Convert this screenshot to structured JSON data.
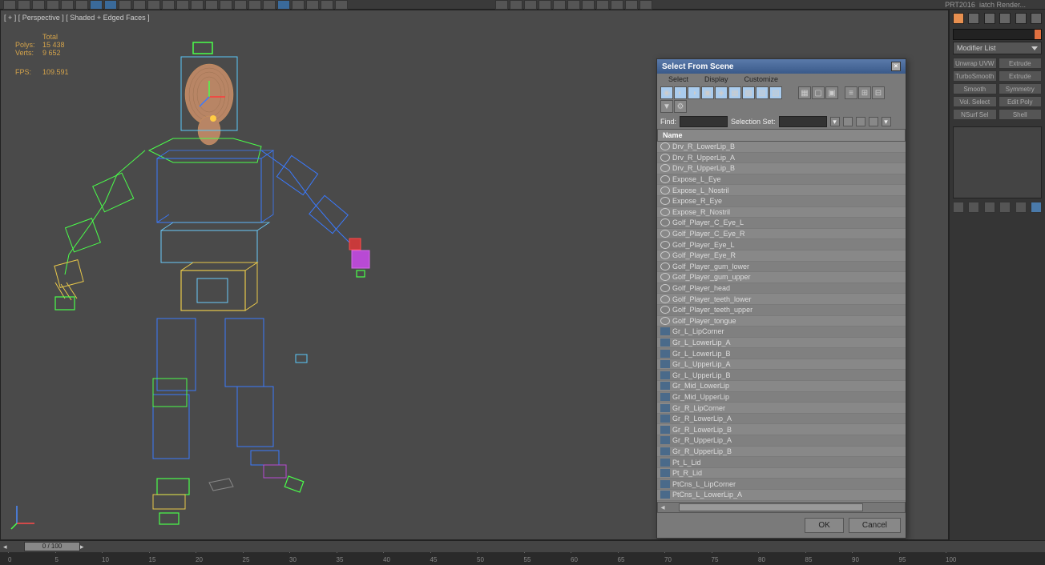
{
  "toolbar": {
    "render_info_1": "PRT2016",
    "render_info_2": "iatch Render..."
  },
  "viewport": {
    "label": "[ + ] [ Perspective ] [ Shaded + Edged Faces ]"
  },
  "stats": {
    "total_label": "Total",
    "polys_label": "Polys:",
    "polys_value": "15 438",
    "verts_label": "Verts:",
    "verts_value": "9 652",
    "fps_label": "FPS:",
    "fps_value": "109.591"
  },
  "dialog": {
    "title": "Select From Scene",
    "tabs": [
      "Select",
      "Display",
      "Customize"
    ],
    "find_label": "Find:",
    "find_value": "",
    "selset_label": "Selection Set:",
    "selset_value": "",
    "header": "Name",
    "items": [
      {
        "icon": "circle",
        "name": "Drv_R_LowerLip_B"
      },
      {
        "icon": "circle",
        "name": "Drv_R_UpperLip_A"
      },
      {
        "icon": "circle",
        "name": "Drv_R_UpperLip_B"
      },
      {
        "icon": "circle",
        "name": "Expose_L_Eye"
      },
      {
        "icon": "circle",
        "name": "Expose_L_Nostril"
      },
      {
        "icon": "circle",
        "name": "Expose_R_Eye"
      },
      {
        "icon": "circle",
        "name": "Expose_R_Nostril"
      },
      {
        "icon": "circle",
        "name": "Golf_Player_C_Eye_L"
      },
      {
        "icon": "circle",
        "name": "Golf_Player_C_Eye_R"
      },
      {
        "icon": "circle",
        "name": "Golf_Player_Eye_L"
      },
      {
        "icon": "circle",
        "name": "Golf_Player_Eye_R"
      },
      {
        "icon": "circle",
        "name": "Golf_Player_gum_lower"
      },
      {
        "icon": "circle",
        "name": "Golf_Player_gum_upper"
      },
      {
        "icon": "circle",
        "name": "Golf_Player_head"
      },
      {
        "icon": "circle",
        "name": "Golf_Player_teeth_lower"
      },
      {
        "icon": "circle",
        "name": "Golf_Player_teeth_upper"
      },
      {
        "icon": "circle",
        "name": "Golf_Player_tongue"
      },
      {
        "icon": "square",
        "name": "Gr_L_LipCorner"
      },
      {
        "icon": "square",
        "name": "Gr_L_LowerLip_A"
      },
      {
        "icon": "square",
        "name": "Gr_L_LowerLip_B"
      },
      {
        "icon": "square",
        "name": "Gr_L_UpperLip_A"
      },
      {
        "icon": "square",
        "name": "Gr_L_UpperLip_B"
      },
      {
        "icon": "square",
        "name": "Gr_Mid_LowerLip"
      },
      {
        "icon": "square",
        "name": "Gr_Mid_UpperLip"
      },
      {
        "icon": "square",
        "name": "Gr_R_LipCorner"
      },
      {
        "icon": "square",
        "name": "Gr_R_LowerLip_A"
      },
      {
        "icon": "square",
        "name": "Gr_R_LowerLip_B"
      },
      {
        "icon": "square",
        "name": "Gr_R_UpperLip_A"
      },
      {
        "icon": "square",
        "name": "Gr_R_UpperLip_B"
      },
      {
        "icon": "square",
        "name": "Pt_L_Lid"
      },
      {
        "icon": "square",
        "name": "Pt_R_Lid"
      },
      {
        "icon": "square",
        "name": "PtCns_L_LipCorner"
      },
      {
        "icon": "square",
        "name": "PtCns_L_LowerLip_A"
      }
    ],
    "ok_label": "OK",
    "cancel_label": "Cancel"
  },
  "right_panel": {
    "modifier_list_label": "Modifier List",
    "buttons": [
      "Unwrap UVW",
      "Extrude",
      "TurboSmooth",
      "Extrude",
      "Smooth",
      "Symmetry",
      "Vol. Select",
      "Edit Poly",
      "NSurf Sel",
      "Shell"
    ]
  },
  "timeline": {
    "handle_text": "0 / 100",
    "ticks": [
      0,
      5,
      10,
      15,
      20,
      25,
      30,
      35,
      40,
      45,
      50,
      55,
      60,
      65,
      70,
      75,
      80,
      85,
      90,
      95,
      100
    ]
  }
}
